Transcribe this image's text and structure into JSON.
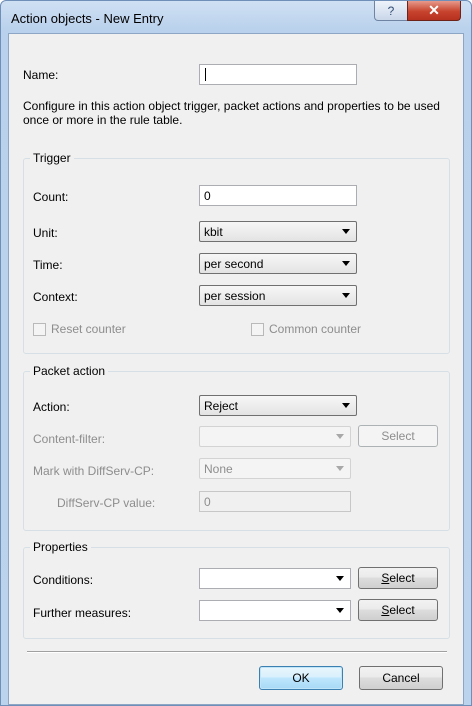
{
  "window": {
    "title": "Action objects - New Entry",
    "help_glyph": "?",
    "close_glyph": "✕"
  },
  "name": {
    "label": "Name:",
    "value": ""
  },
  "description": "Configure in this action object trigger, packet actions and properties to be used once or more in the rule table.",
  "trigger": {
    "title": "Trigger",
    "count_label": "Count:",
    "count_value": "0",
    "unit_label": "Unit:",
    "unit_value": "kbit",
    "time_label": "Time:",
    "time_value": "per second",
    "context_label": "Context:",
    "context_value": "per session",
    "reset_counter_label": "Reset counter",
    "common_counter_label": "Common counter"
  },
  "packet_action": {
    "title": "Packet action",
    "action_label": "Action:",
    "action_value": "Reject",
    "content_filter_label": "Content-filter:",
    "content_filter_value": "",
    "content_filter_select_label": "Select",
    "mark_label": "Mark with DiffServ-CP:",
    "mark_value": "None",
    "diffserv_value_label": "DiffServ-CP value:",
    "diffserv_value": "0"
  },
  "properties": {
    "title": "Properties",
    "conditions_label": "Conditions:",
    "conditions_value": "",
    "further_label": "Further measures:",
    "further_value": "",
    "select_label_prefix": "",
    "select_label_ul": "S",
    "select_label_rest": "elect"
  },
  "footer": {
    "ok_label": "OK",
    "cancel_label": "Cancel"
  },
  "colors": {
    "title_bar": "#bcd3ed",
    "close_button": "#c7432e",
    "dialog_bg": "#f0f0f0"
  }
}
